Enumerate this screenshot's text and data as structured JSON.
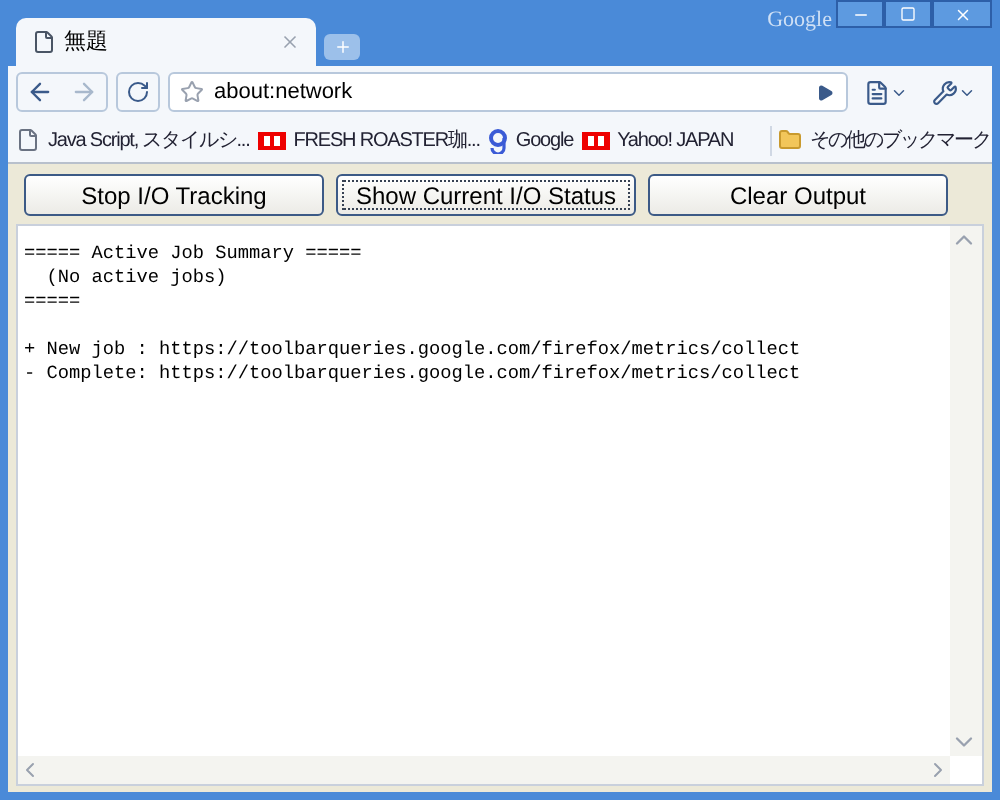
{
  "window": {
    "brand": "Google",
    "tab_title": "無題"
  },
  "toolbar": {
    "address": "about:network"
  },
  "bookmarks": [
    {
      "label": "Java Script, スタイルシ...",
      "kind": "page"
    },
    {
      "label": "FRESH ROASTER珈...",
      "kind": "yahoo"
    },
    {
      "label": "Google",
      "kind": "google"
    },
    {
      "label": "Yahoo!  JAPAN",
      "kind": "yahoo"
    }
  ],
  "other_bookmarks": "その他のブックマーク",
  "buttons": [
    {
      "label": "Stop I/O Tracking",
      "focused": false
    },
    {
      "label": "Show Current I/O Status",
      "focused": true
    },
    {
      "label": "Clear Output",
      "focused": false
    }
  ],
  "output": [
    [
      "===== Active Job Summary =====",
      "  (No active jobs)",
      "====="
    ],
    [
      "+ New job : https://toolbarqueries.google.com/firefox/metrics/collect",
      "- Complete: https://toolbarqueries.google.com/firefox/metrics/collect"
    ]
  ]
}
